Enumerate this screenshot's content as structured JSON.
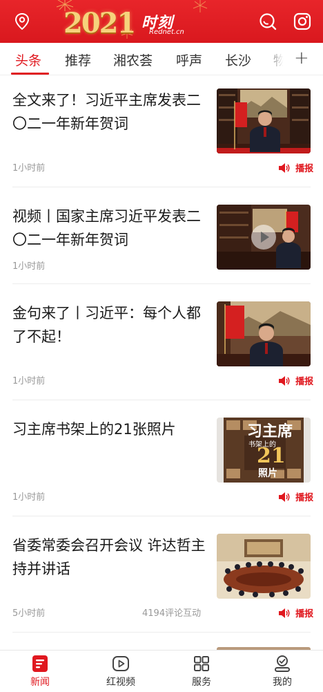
{
  "header": {
    "year": "2021",
    "brand": "时刻",
    "brand_sub": "Rednet.cn",
    "icons": [
      "location-icon",
      "search-icon",
      "instagram-camera-icon"
    ],
    "bg_color": "#e01f24"
  },
  "tabs": [
    {
      "label": "头条",
      "active": true
    },
    {
      "label": "推荐"
    },
    {
      "label": "湘农荟"
    },
    {
      "label": "呼声"
    },
    {
      "label": "长沙"
    },
    {
      "label": "物"
    }
  ],
  "tab_add": "+",
  "articles": [
    {
      "title": "全文来了！习近平主席发表二〇二一年新年贺词",
      "time": "1小时前",
      "broadcast": "播报"
    },
    {
      "title": "视频丨国家主席习近平发表二〇二一年新年贺词",
      "time": "1小时前",
      "video": true
    },
    {
      "title": "金句来了丨习近平：每个人都了不起！",
      "time": "1小时前",
      "broadcast": "播报"
    },
    {
      "title": "习主席书架上的21张照片",
      "time": "1小时前",
      "broadcast": "播报",
      "thumb_text": {
        "title": "习主席",
        "subtitle": "书架上的",
        "number": "21",
        "suffix": "照片"
      }
    },
    {
      "title": "省委常委会召开会议 许达哲主持并讲话",
      "time": "5小时前",
      "comments": "4194评论互动",
      "broadcast": "播报"
    }
  ],
  "bottom_nav": [
    {
      "label": "新闻",
      "icon": "news-icon",
      "active": true
    },
    {
      "label": "红视频",
      "icon": "video-play-icon"
    },
    {
      "label": "服务",
      "icon": "services-grid-icon"
    },
    {
      "label": "我的",
      "icon": "profile-icon"
    }
  ],
  "accent_color": "#e0181f"
}
